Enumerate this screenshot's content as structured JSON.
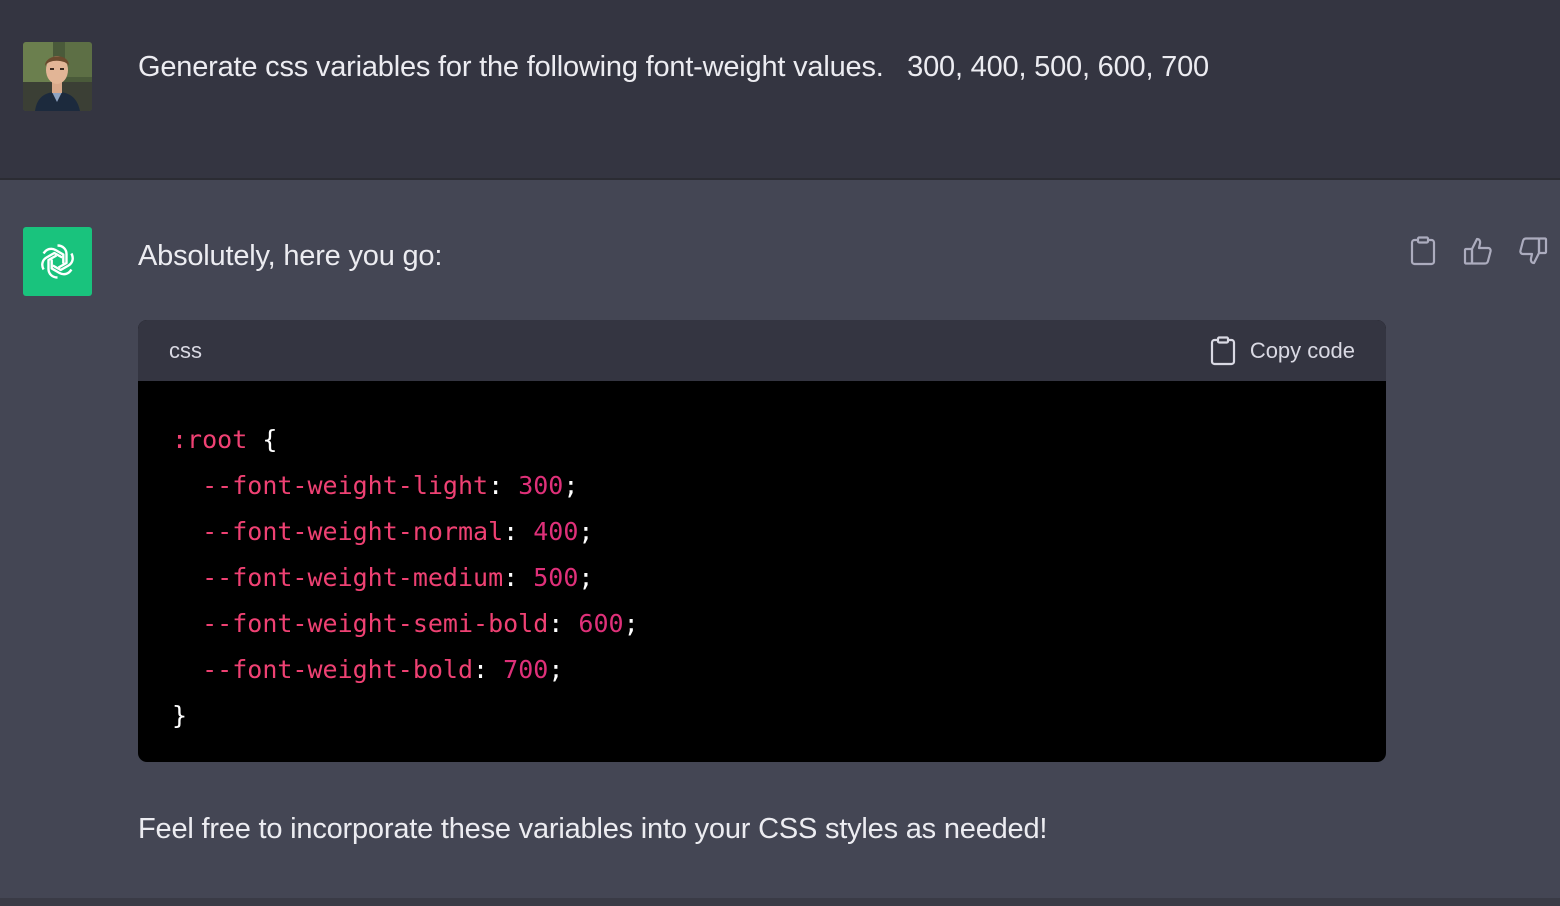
{
  "user": {
    "avatar": "user-photo-avatar",
    "message": "Generate css variables for the following font-weight values.   300, 400, 500, 600, 700"
  },
  "assistant": {
    "avatar": "openai-logo-icon",
    "intro": "Absolutely, here you go:",
    "outro": "Feel free to incorporate these variables into your CSS styles as needed!",
    "actions": [
      "clipboard-icon",
      "thumbs-up-icon",
      "thumbs-down-icon"
    ]
  },
  "code_block": {
    "language": "css",
    "copy_label": "Copy code",
    "selector": ":root",
    "open_brace": " {",
    "close_brace": "}",
    "declarations": [
      {
        "property": "--font-weight-light",
        "value": "300"
      },
      {
        "property": "--font-weight-normal",
        "value": "400"
      },
      {
        "property": "--font-weight-medium",
        "value": "500"
      },
      {
        "property": "--font-weight-semi-bold",
        "value": "600"
      },
      {
        "property": "--font-weight-bold",
        "value": "700"
      }
    ]
  },
  "colors": {
    "user_bg": "#343541",
    "assistant_bg": "#444654",
    "avatar_green": "#19c37d",
    "code_bg": "#000000",
    "code_header_bg": "#343541",
    "code_accent": "#df3079"
  }
}
